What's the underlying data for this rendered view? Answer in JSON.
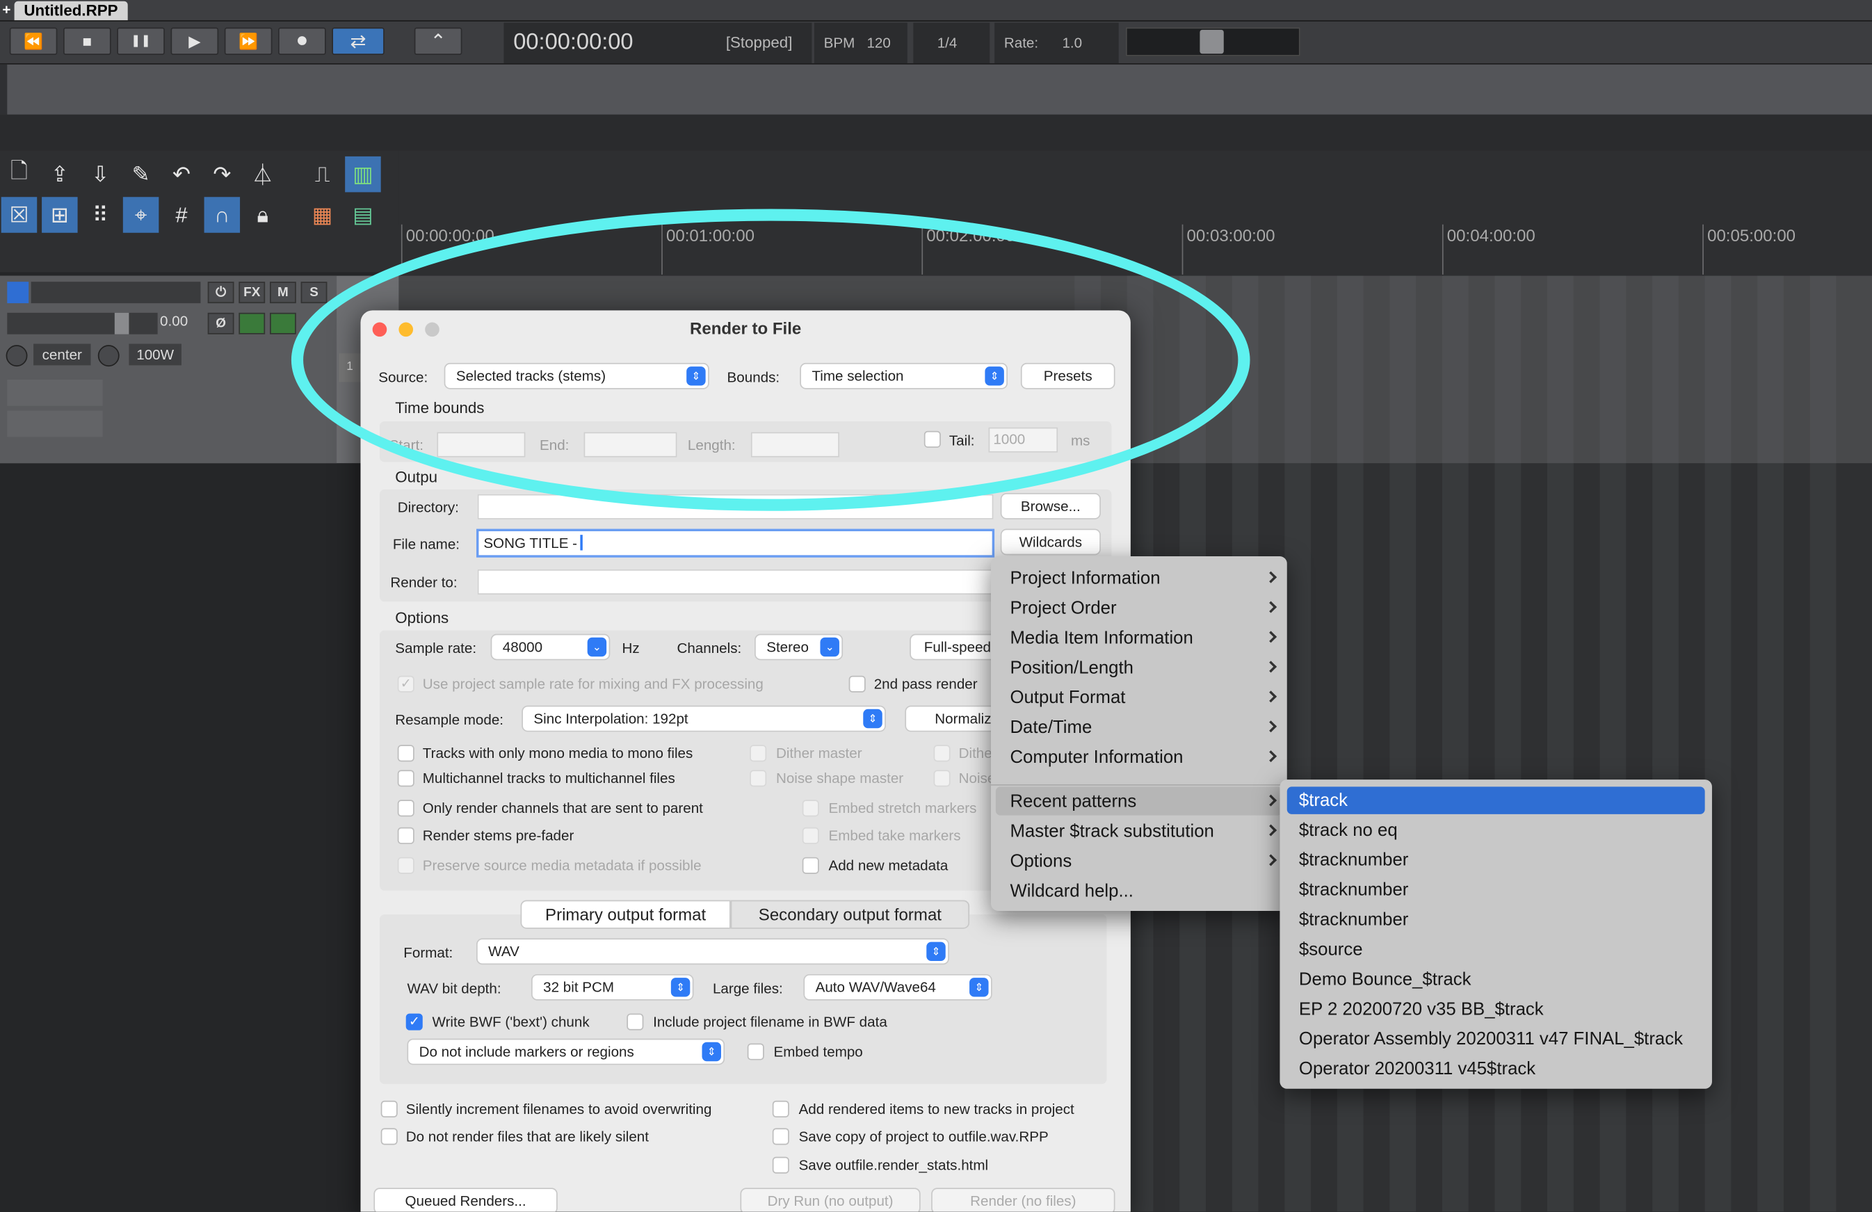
{
  "window": {
    "tab_plus": "+",
    "project_tab": "Untitled.RPP"
  },
  "transport": {
    "timecode": "00:00:00:00",
    "status": "[Stopped]",
    "bpm_label": "BPM",
    "bpm_value": "120",
    "time_sig": "1/4",
    "rate_label": "Rate:",
    "rate_value": "1.0",
    "buttons": {
      "rewind": "⏪",
      "stop": "■",
      "pause": "❚❚",
      "play": "▶",
      "ffwd": "⏩",
      "record": "⏺",
      "repeat": "⇄",
      "auto": "⌃"
    }
  },
  "toolbar": {
    "icons": [
      "new-project-icon",
      "open-project-icon",
      "save-project-icon",
      "preferences-wrench-icon",
      "undo-icon",
      "redo-icon",
      "metronome-icon",
      "item-grouping-icon",
      "snap-icon",
      "grid-icon",
      "ripple-icon",
      "grid-lines-icon",
      "magnet-icon",
      "lock-icon",
      "mixer-icon",
      "meter-icon",
      "color-icon",
      "region-icon"
    ]
  },
  "timeline": {
    "markers": [
      "00:00:00:00",
      "00:01:00:00",
      "00:02:00:00",
      "00:03:00:00",
      "00:04:00:00",
      "00:05:00:00"
    ]
  },
  "track": {
    "buttons": {
      "power": "⏻",
      "fx": "FX",
      "mute": "M",
      "solo": "S",
      "phase": "Ø"
    },
    "volume": "0.00",
    "pan": "center",
    "width": "100W",
    "number": "1"
  },
  "dialog": {
    "title": "Render to File",
    "source_label": "Source:",
    "source_value": "Selected tracks (stems)",
    "bounds_label": "Bounds:",
    "bounds_value": "Time selection",
    "presets": "Presets",
    "time_bounds": "Time bounds",
    "start": "Start:",
    "end": "End:",
    "length": "Length:",
    "tail": "Tail:",
    "tail_value": "1000",
    "tail_unit": "ms",
    "output": "Outpu",
    "directory": "Directory:",
    "browse": "Browse...",
    "file_name": "File name:",
    "file_name_value": "SONG TITLE -",
    "wildcards": "Wildcards",
    "render_to": "Render to:",
    "options": "Options",
    "sample_rate_label": "Sample rate:",
    "sample_rate": "48000",
    "hz": "Hz",
    "channels_label": "Channels:",
    "channels": "Stereo",
    "full_speed": "Full-speed",
    "use_project_rate": "Use project sample rate for mixing and FX processing",
    "second_pass": "2nd pass render",
    "resample_label": "Resample mode:",
    "resample": "Sinc Interpolation: 192pt",
    "normalize": "Normaliz",
    "mono_media": "Tracks with only mono media to mono files",
    "multichannel": "Multichannel tracks to multichannel files",
    "only_parent": "Only render channels that are sent to parent",
    "stems_prefader": "Render stems pre-fader",
    "preserve_metadata": "Preserve source media metadata if possible",
    "dither_master": "Dither master",
    "noise_shape_master": "Noise shape master",
    "dither_trunc": "Dithe",
    "noise_trunc": "Noise",
    "embed_stretch": "Embed stretch markers",
    "embed_take": "Embed take markers",
    "add_metadata": "Add new metadata",
    "primary_tab": "Primary output format",
    "secondary_tab": "Secondary output format",
    "format_label": "Format:",
    "format": "WAV",
    "bit_depth_label": "WAV bit depth:",
    "bit_depth": "32 bit PCM",
    "large_files_label": "Large files:",
    "large_files": "Auto WAV/Wave64",
    "write_bwf": "Write BWF ('bext') chunk",
    "include_filename": "Include project filename in BWF data",
    "markers_select": "Do not include markers or regions",
    "embed_tempo": "Embed tempo",
    "silently_increment": "Silently increment filenames to avoid overwriting",
    "no_silent": "Do not render files that are likely silent",
    "add_rendered": "Add rendered items to new tracks in project",
    "save_copy": "Save copy of project to outfile.wav.RPP",
    "save_stats": "Save outfile.render_stats.html",
    "queued": "Queued Renders...",
    "dry_run": "Dry Run (no output)",
    "render_nofiles": "Render (no files)"
  },
  "wildcards_menu": {
    "items": [
      "Project Information",
      "Project Order",
      "Media Item Information",
      "Position/Length",
      "Output Format",
      "Date/Time",
      "Computer Information",
      "Recent patterns",
      "Master $track substitution",
      "Options",
      "Wildcard help..."
    ]
  },
  "recent_patterns": {
    "items": [
      "$track",
      "$track no eq",
      "$tracknumber",
      "$tracknumber",
      "$tracknumber",
      "$source",
      "Demo Bounce_$track",
      "EP 2 20200720 v35 BB_$track",
      "Operator Assembly 20200311 v47 FINAL_$track",
      "Operator 20200311 v45$track"
    ]
  },
  "colors": {
    "accent": "#2f7bf6",
    "highlight": "#2f6ed3",
    "annotation": "#5ef1ef"
  }
}
